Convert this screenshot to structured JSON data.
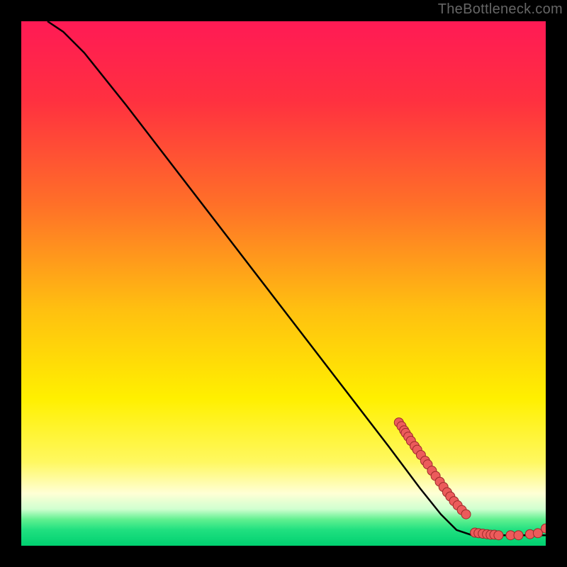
{
  "watermark": "TheBottleneck.com",
  "chart_data": {
    "type": "line",
    "title": "",
    "xlabel": "",
    "ylabel": "",
    "xlim": [
      0,
      100
    ],
    "ylim": [
      0,
      100
    ],
    "curve": [
      {
        "x": 5,
        "y": 100
      },
      {
        "x": 8,
        "y": 98
      },
      {
        "x": 12,
        "y": 94
      },
      {
        "x": 20,
        "y": 84
      },
      {
        "x": 30,
        "y": 71
      },
      {
        "x": 40,
        "y": 58
      },
      {
        "x": 50,
        "y": 45
      },
      {
        "x": 60,
        "y": 32
      },
      {
        "x": 70,
        "y": 19
      },
      {
        "x": 76,
        "y": 11
      },
      {
        "x": 80,
        "y": 6
      },
      {
        "x": 83,
        "y": 3
      },
      {
        "x": 86,
        "y": 2
      },
      {
        "x": 100,
        "y": 2
      }
    ],
    "scatter": [
      {
        "x": 72,
        "y": 23.5
      },
      {
        "x": 72.5,
        "y": 22.8
      },
      {
        "x": 73,
        "y": 22
      },
      {
        "x": 73.3,
        "y": 21.5
      },
      {
        "x": 73.8,
        "y": 20.8
      },
      {
        "x": 74.3,
        "y": 20
      },
      {
        "x": 75,
        "y": 19
      },
      {
        "x": 75.5,
        "y": 18.3
      },
      {
        "x": 76.2,
        "y": 17.3
      },
      {
        "x": 77,
        "y": 16.2
      },
      {
        "x": 77.5,
        "y": 15.5
      },
      {
        "x": 78.3,
        "y": 14.3
      },
      {
        "x": 79,
        "y": 13.3
      },
      {
        "x": 79.8,
        "y": 12.2
      },
      {
        "x": 80.5,
        "y": 11.2
      },
      {
        "x": 81.2,
        "y": 10.2
      },
      {
        "x": 81.8,
        "y": 9.4
      },
      {
        "x": 82.5,
        "y": 8.5
      },
      {
        "x": 83.2,
        "y": 7.7
      },
      {
        "x": 84,
        "y": 6.8
      },
      {
        "x": 84.8,
        "y": 6
      },
      {
        "x": 86.5,
        "y": 2.5
      },
      {
        "x": 87.2,
        "y": 2.4
      },
      {
        "x": 88,
        "y": 2.3
      },
      {
        "x": 88.8,
        "y": 2.2
      },
      {
        "x": 89.5,
        "y": 2.1
      },
      {
        "x": 90.2,
        "y": 2.1
      },
      {
        "x": 91,
        "y": 2
      },
      {
        "x": 93.3,
        "y": 2
      },
      {
        "x": 94.8,
        "y": 2
      },
      {
        "x": 97,
        "y": 2.2
      },
      {
        "x": 98.5,
        "y": 2.4
      },
      {
        "x": 100,
        "y": 3.3
      }
    ],
    "gradient_stops": [
      {
        "offset": 0.0,
        "color": "#ff1a55"
      },
      {
        "offset": 0.15,
        "color": "#ff3040"
      },
      {
        "offset": 0.35,
        "color": "#ff7028"
      },
      {
        "offset": 0.55,
        "color": "#ffc010"
      },
      {
        "offset": 0.72,
        "color": "#fff000"
      },
      {
        "offset": 0.84,
        "color": "#fff860"
      },
      {
        "offset": 0.9,
        "color": "#ffffd5"
      },
      {
        "offset": 0.93,
        "color": "#d0ffd0"
      },
      {
        "offset": 0.95,
        "color": "#60f090"
      },
      {
        "offset": 0.97,
        "color": "#20e080"
      },
      {
        "offset": 1.0,
        "color": "#00d070"
      }
    ],
    "marker_color": "#ec5b5b",
    "marker_stroke": "#9c2a2a",
    "curve_color": "#000000"
  }
}
